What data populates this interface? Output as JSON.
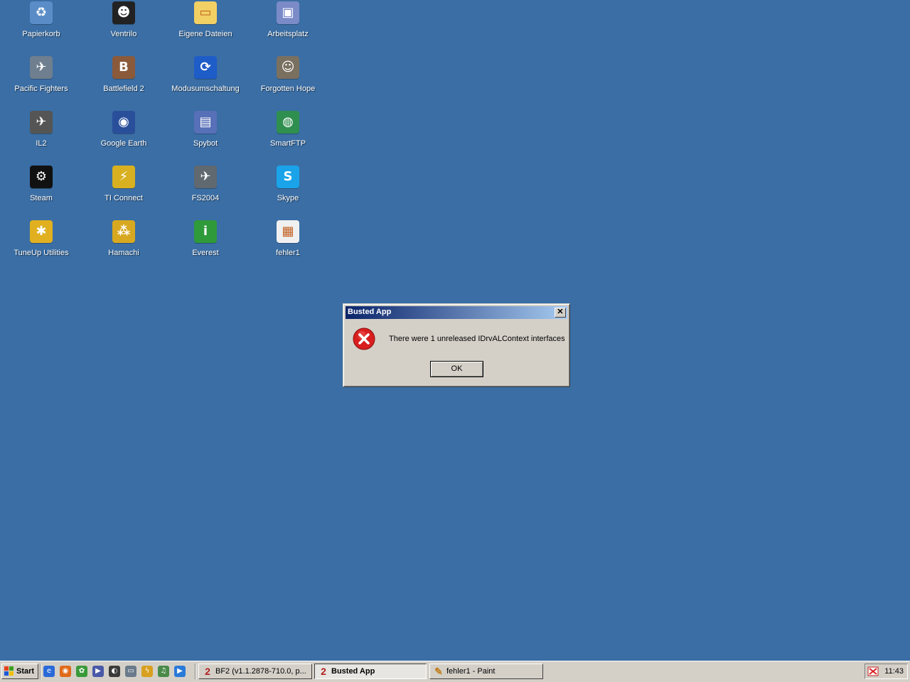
{
  "desktop": {
    "background_color": "#3a6ea5",
    "icons": [
      {
        "label": "Papierkorb",
        "icon": "recycle-bin-icon",
        "color": "#5a8dc8"
      },
      {
        "label": "Ventrilo",
        "icon": "ventrilo-icon",
        "color": "#222222"
      },
      {
        "label": "Eigene Dateien",
        "icon": "folder-icon",
        "color": "#f2d064"
      },
      {
        "label": "Arbeitsplatz",
        "icon": "computer-icon",
        "color": "#7b8bc8"
      },
      {
        "label": "Pacific Fighters",
        "icon": "plane-icon",
        "color": "#6f7f8f"
      },
      {
        "label": "Battlefield 2",
        "icon": "battlefield-icon",
        "color": "#8a5a3a"
      },
      {
        "label": "Modusumschaltung",
        "icon": "mode-switch-icon",
        "color": "#1e5cc8"
      },
      {
        "label": "Forgotten Hope",
        "icon": "soldier-icon",
        "color": "#7a7060"
      },
      {
        "label": "IL2",
        "icon": "il2-icon",
        "color": "#555555"
      },
      {
        "label": "Google Earth",
        "icon": "globe-icon",
        "color": "#2a4f9a"
      },
      {
        "label": "Spybot",
        "icon": "spybot-icon",
        "color": "#5870b8"
      },
      {
        "label": "SmartFTP",
        "icon": "smartftp-icon",
        "color": "#2f8f4f"
      },
      {
        "label": "Steam",
        "icon": "steam-icon",
        "color": "#111111"
      },
      {
        "label": "TI Connect",
        "icon": "ti-connect-icon",
        "color": "#d8b020"
      },
      {
        "label": "FS2004",
        "icon": "airplane-icon",
        "color": "#606870"
      },
      {
        "label": "Skype",
        "icon": "skype-icon",
        "color": "#1aa3e8"
      },
      {
        "label": "TuneUp Utilities",
        "icon": "tuneup-icon",
        "color": "#e0b020"
      },
      {
        "label": "Hamachi",
        "icon": "hamachi-icon",
        "color": "#d8a820"
      },
      {
        "label": "Everest",
        "icon": "info-icon",
        "color": "#2f9a3a"
      },
      {
        "label": "fehler1",
        "icon": "image-file-icon",
        "color": "#f0f0f0"
      }
    ]
  },
  "dialog": {
    "title": "Busted App",
    "message": "There were 1 unreleased IDrvALContext interfaces",
    "ok_label": "OK",
    "close_glyph": "✕"
  },
  "taskbar": {
    "start_label": "Start",
    "quick_launch": [
      {
        "icon": "ie-icon",
        "color": "#2a6ad8"
      },
      {
        "icon": "firefox-icon",
        "color": "#e06a1a"
      },
      {
        "icon": "icq-icon",
        "color": "#3a9a3a"
      },
      {
        "icon": "media-icon",
        "color": "#4a5aa8"
      },
      {
        "icon": "teamspeak-icon",
        "color": "#3a3a3a"
      },
      {
        "icon": "terminal-icon",
        "color": "#6a7a8a"
      },
      {
        "icon": "winamp-icon",
        "color": "#d8a020"
      },
      {
        "icon": "music-icon",
        "color": "#4a8a4a"
      },
      {
        "icon": "player-icon",
        "color": "#2a7ad8"
      }
    ],
    "tasks": [
      {
        "label": "BF2 (v1.1.2878-710.0, p...",
        "icon": "bf2-task-icon",
        "active": false
      },
      {
        "label": "Busted App",
        "icon": "bf2-task-icon",
        "active": true
      },
      {
        "label": "fehler1 - Paint",
        "icon": "paint-icon",
        "active": false
      }
    ],
    "clock": "11:43"
  }
}
